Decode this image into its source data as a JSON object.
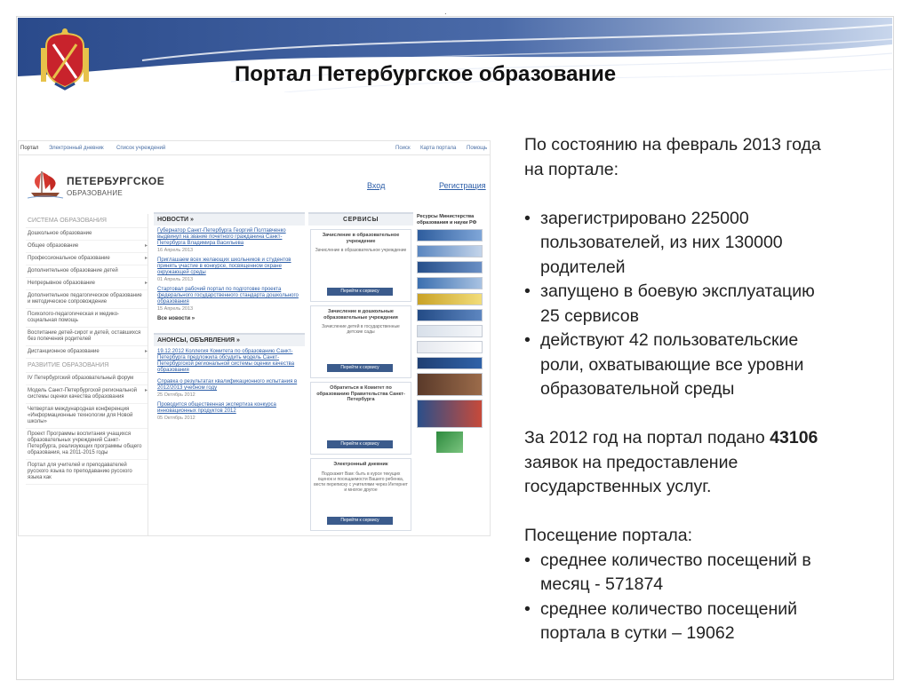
{
  "slide": {
    "title": "Портал Петербургское образование",
    "dot": ".",
    "colors": {
      "banner_blue": "#2a4a8b",
      "banner_light": "#c8d6ec"
    }
  },
  "portal_screenshot": {
    "topbar": [
      "Портал",
      "Электронный дневник",
      "Список учреждений",
      "Поиск",
      "Карта портала",
      "Помощь"
    ],
    "brand_name": "ПЕТЕРБУРГСКОЕ",
    "brand_sub": "ОБРАЗОВАНИЕ",
    "login_label": "Вход",
    "register_label": "Регистрация",
    "left_menu_head1": "Система образования",
    "left_menu1": [
      "Дошкольное образование",
      "Общее образование",
      "Профессиональное образование",
      "Дополнительное образование детей",
      "Непрерывное образование",
      "Дополнительное педагогическое образование и методическое сопровождение",
      "Психолого-педагогическая и медико-социальная помощь",
      "Воспитание детей-сирот и детей, оставшихся без попечения родителей",
      "Дистанционное образование"
    ],
    "left_menu_head2": "Развитие образования",
    "left_menu2": [
      "IV Петербургский образовательный форум",
      "Модель Санкт-Петербургской региональной системы оценки качества образования",
      "Четвертая международная конференция «Информационные технологии для Новой школы»",
      "Проект Программы воспитания учащихся образовательных учреждений Санкт-Петербурга, реализующих программы общего образования, на 2011-2015 годы",
      "Портал для учителей и преподавателей русского языка по преподаванию русского языка как"
    ],
    "news_head": "НОВОСТИ »",
    "news": [
      {
        "text": "Губернатор Санкт-Петербурга Георгий Полтавченко выдвинул на звание почетного гражданина Санкт-Петербурга Владимира Васильева",
        "date": "16 Апрель 2013"
      },
      {
        "text": "Приглашаем всех желающих школьников и студентов принять участие в конкурсе, посвященном охране окружающей среды",
        "date": "01 Апрель 2013"
      },
      {
        "text": "Стартовал рабочий портал по подготовке проекта федерального государственного стандарта дошкольного образования",
        "date": "15 Апрель 2013"
      }
    ],
    "all_news": "Все новости »",
    "announce_head": "АНОНСЫ, ОБЪЯВЛЕНИЯ »",
    "announce": [
      {
        "text": "19.12.2012 Коллегия Комитета по образованию Санкт-Петербурга предложила обсудить модель Санкт-Петербургской региональной системы оценки качества образования",
        "date": ""
      },
      {
        "text": "Справка о результатах квалификационного испытания в 2012/2013 учебном году",
        "date": "25 Октябрь 2012"
      },
      {
        "text": "Проводится общественная экспертиза конкурса инновационных продуктов 2012",
        "date": "05 Октябрь 2012"
      }
    ],
    "services_head": "СЕРВИСЫ",
    "services": [
      {
        "title": "Зачисление в образовательное учреждение",
        "desc": "Зачисление в образовательное учреждение",
        "button": "Перейти к сервису"
      },
      {
        "title": "Зачисление в дошкольные образовательные учреждения",
        "desc": "Зачисление детей в государственные детские сады",
        "button": "Перейти к сервису"
      },
      {
        "title": "Обратиться в Комитет по образованию Правительства Санкт-Петербурга",
        "desc": "",
        "button": "Перейти к сервису"
      },
      {
        "title": "Электронный дневник",
        "desc": "Подскажет Вам: быть в курсе текущих оценок и посещаемости Вашего ребенка, вести переписку с учителями через Интернет и многое другое",
        "button": "Перейти к сервису"
      }
    ],
    "resources_head": "Ресурсы Министерства образования и науки РФ"
  },
  "content": {
    "intro": [
      "По состоянию на февраль 2013 года",
      "на портале:"
    ],
    "bullets1": [
      [
        "зарегистрировано 225000",
        "пользователей, из них 130000",
        "родителей"
      ],
      [
        "запущено в боевую эксплуатацию",
        "25 сервисов"
      ],
      [
        "действуют 42 пользовательские",
        "роли, охватывающие все уровни",
        "образовательной среды"
      ]
    ],
    "applications_prefix": "За 2012 год на портал подано ",
    "applications_number": "43106",
    "applications_rest": [
      "заявок на предоставление",
      "государственных услуг."
    ],
    "visits_head": "Посещение портала:",
    "bullets2": [
      [
        "среднее количество посещений в",
        "месяц -  571874"
      ],
      [
        "среднее количество посещений",
        "портала в сутки – 19062"
      ]
    ]
  }
}
